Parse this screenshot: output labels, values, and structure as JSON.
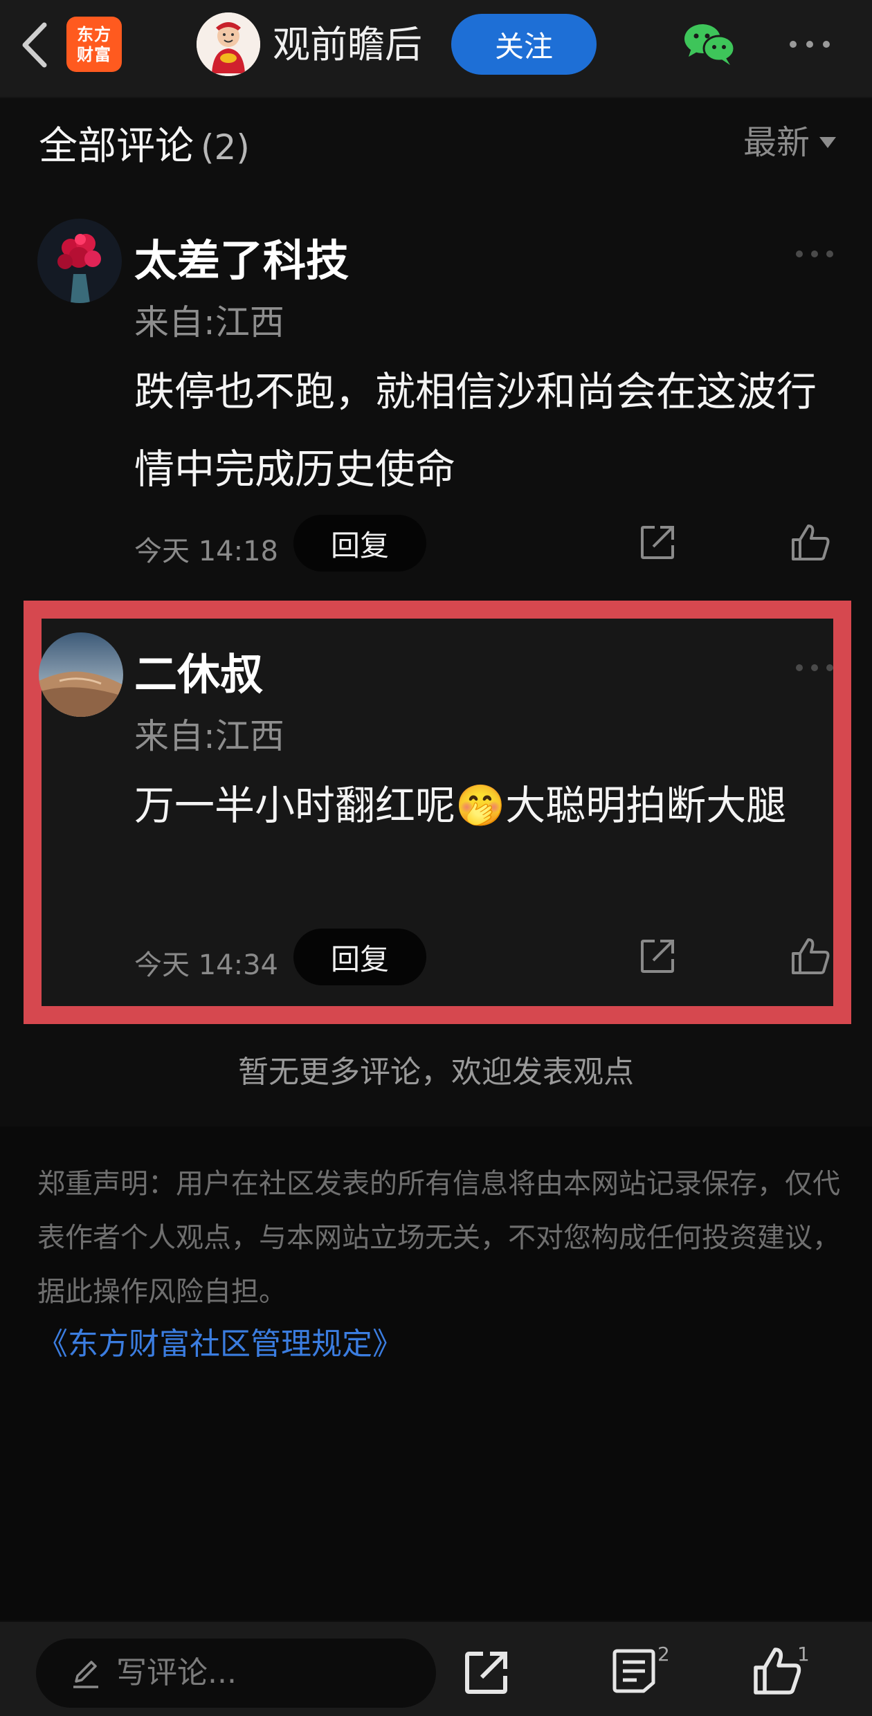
{
  "header": {
    "logo_line1": "东方",
    "logo_line2": "财富",
    "author_name": "观前瞻后",
    "follow_label": "关注"
  },
  "comments_section": {
    "title": "全部评论",
    "count": "(2)",
    "sort_label": "最新"
  },
  "comments": [
    {
      "username": "太差了科技",
      "location": "来自:江西",
      "text": "跌停也不跑，就相信沙和尚会在这波行情中完成历史使命",
      "time": "今天 14:18",
      "reply_label": "回复"
    },
    {
      "username": "二休叔",
      "location": "来自:江西",
      "text": "万一半小时翻红呢🤭大聪明拍断大腿",
      "time": "今天 14:34",
      "reply_label": "回复"
    }
  ],
  "no_more_text": "暂无更多评论，欢迎发表观点",
  "disclaimer": "郑重声明：用户在社区发表的所有信息将由本网站记录保存，仅代表作者个人观点，与本网站立场无关，不对您构成任何投资建议，据此操作风险自担。",
  "rules_link": "《东方财富社区管理规定》",
  "bottom_bar": {
    "input_placeholder": "写评论...",
    "comment_count": "2",
    "like_count": "1"
  },
  "colors": {
    "accent_blue": "#1e6fd6",
    "highlight_red": "#d6484f",
    "logo_orange": "#ff5a1f",
    "wechat_green": "#3ec55a"
  }
}
